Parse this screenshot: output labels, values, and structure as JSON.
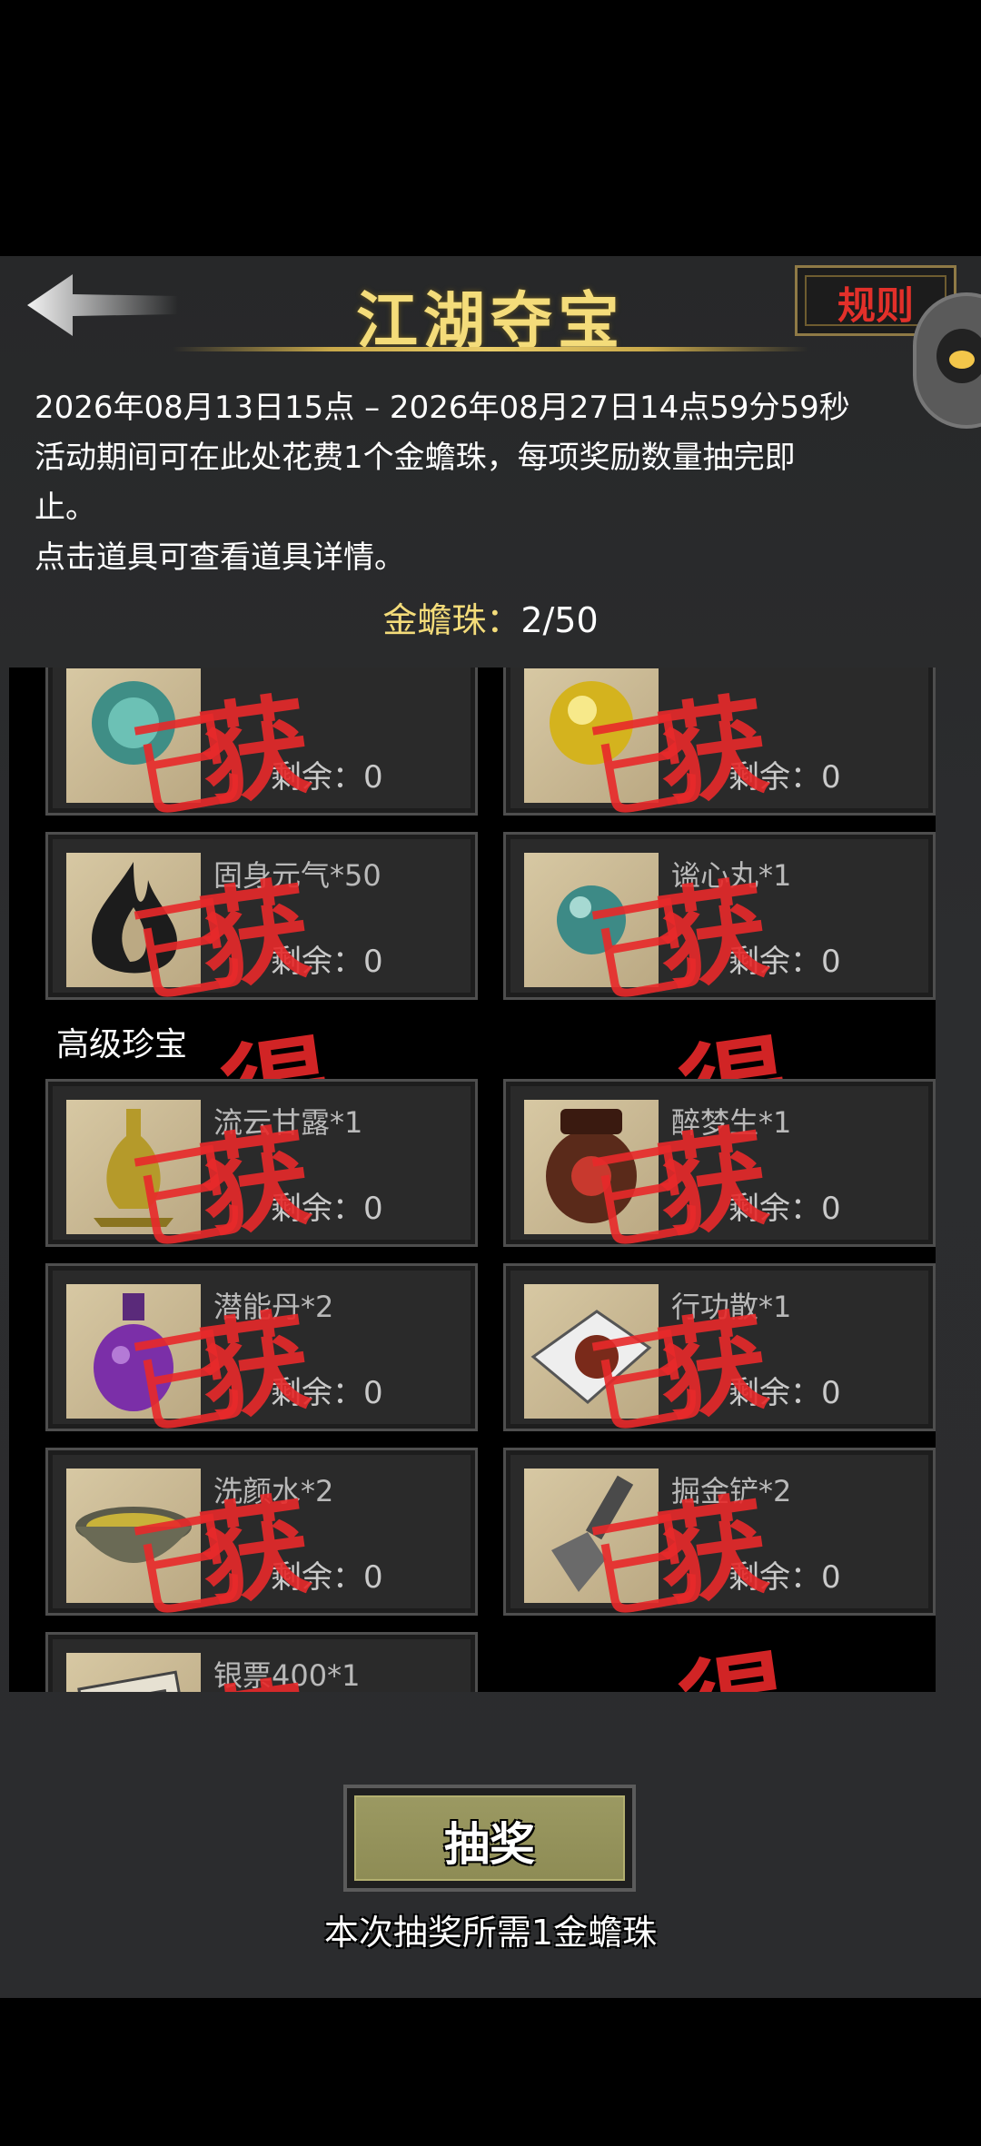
{
  "header": {
    "title": "江湖夺宝",
    "rules_label": "规则"
  },
  "info": {
    "period": "2026年08月13日15点 – 2026年08月27日14点59分59秒",
    "line1": "活动期间可在此处花费1个金蟾珠，每项奖励数量抽完即",
    "line2": "止。",
    "line3": "点击道具可查看道具详情。"
  },
  "currency": {
    "label": "金蟾珠：",
    "value": "2/50"
  },
  "stamp_text": "获得",
  "stamp_prefix": "已",
  "remain_label": "剩余：0",
  "cards_top": [
    {
      "name": ""
    },
    {
      "name": ""
    },
    {
      "name": "固身元气*50"
    },
    {
      "name": "谧心丸*1"
    }
  ],
  "section_advanced": "高级珍宝",
  "cards_advanced": [
    {
      "name": "流云甘露*1"
    },
    {
      "name": "醉梦生*1"
    },
    {
      "name": "潜能丹*2"
    },
    {
      "name": "行功散*1"
    },
    {
      "name": "洗颜水*2"
    },
    {
      "name": "掘金铲*2"
    },
    {
      "name": "银票400*1"
    }
  ],
  "footer": {
    "draw_label": "抽奖",
    "note": "本次抽奖所需1金蟾珠"
  },
  "colors": {
    "accent_gold": "#f4dc7a",
    "stamp_red": "#e8292a",
    "button_olive": "#9b9962"
  }
}
